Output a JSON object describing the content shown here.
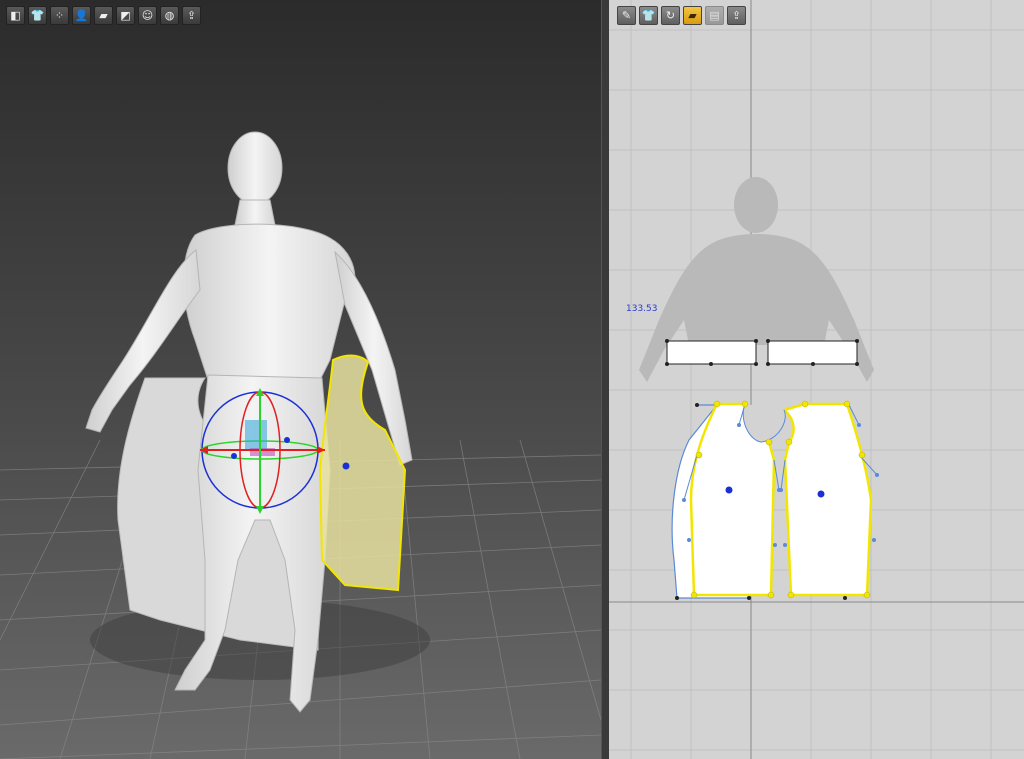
{
  "viewport3d": {
    "toolbar": [
      {
        "icon": "cube-icon",
        "glyph": "◧"
      },
      {
        "icon": "shirt-icon",
        "glyph": "👕"
      },
      {
        "icon": "points-icon",
        "glyph": "⁘"
      },
      {
        "icon": "avatar-select-icon",
        "glyph": "👤"
      },
      {
        "icon": "fabric-icon",
        "glyph": "▰"
      },
      {
        "icon": "texture-icon",
        "glyph": "◩"
      },
      {
        "icon": "avatar-icon",
        "glyph": "☺"
      },
      {
        "icon": "globe-icon",
        "glyph": "◍"
      },
      {
        "icon": "export-icon",
        "glyph": "⇪"
      }
    ]
  },
  "viewport2d": {
    "toolbar": [
      {
        "icon": "pen-icon",
        "glyph": "✎",
        "active": false
      },
      {
        "icon": "shirt-icon",
        "glyph": "👕",
        "active": false
      },
      {
        "icon": "rotate-icon",
        "glyph": "↻",
        "active": false
      },
      {
        "icon": "fabric-icon",
        "glyph": "▰",
        "active": true
      },
      {
        "icon": "pattern-icon",
        "glyph": "▤",
        "active": false
      },
      {
        "icon": "export-icon",
        "glyph": "⇪",
        "active": false
      }
    ],
    "measurement": "133.53"
  },
  "colors": {
    "selected": "#f2e600",
    "accent_blue": "#1a2fd6",
    "panel_bg": "#d3d3d3",
    "grid_line": "#bdbdbd",
    "axis_line": "#888888"
  }
}
